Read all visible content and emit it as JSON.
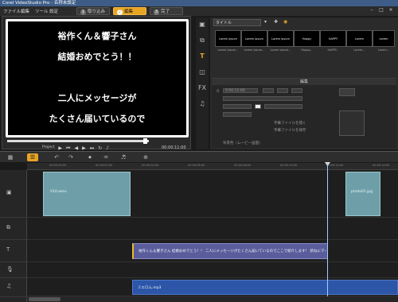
{
  "window": {
    "title": "Corel VideoStudio Pro - 名称未設定"
  },
  "menu": [
    "ファイル",
    "編集",
    "ツール",
    "設定"
  ],
  "steps": [
    {
      "num": "1",
      "label": "取り込み",
      "active": false
    },
    {
      "num": "2",
      "label": "編集",
      "active": true
    },
    {
      "num": "3",
      "label": "完了",
      "active": false
    }
  ],
  "preview": {
    "lines": [
      "裕作くん＆響子さん",
      "結婚おめでとう！！",
      "",
      "二人にメッセージが",
      "たくさん届いているので"
    ],
    "progress": 0.97,
    "mode_label": "Project",
    "timecode": "00:00:11:00"
  },
  "library": {
    "category": "タイトル",
    "thumbs": [
      {
        "text": "Lorem ipsum",
        "label": "Lorem ipsum..."
      },
      {
        "text": "Lorem ipsum",
        "label": "Lorem ipsum..."
      },
      {
        "text": "Lorem ipsum",
        "label": "Lorem ipsum..."
      },
      {
        "text": "Happy",
        "label": "Happy..."
      },
      {
        "text": "HAPPY",
        "label": "HAPPY..."
      },
      {
        "text": "Lorem",
        "label": "Lorem..."
      },
      {
        "text": "Lorem",
        "label": "Lorem..."
      }
    ],
    "edit_header": "編集",
    "edit_timecode": "0:00:11:00",
    "style_file": "字幕ファイルを開く",
    "save_style": "字幕ファイルを保存",
    "text_bg": "背景色（ムービー画面）"
  },
  "timeline": {
    "ruler": [
      "00:00:00:00",
      "00:00:02:00",
      "00:00:04:00",
      "00:00:06:00",
      "00:00:08:00",
      "00:00:10:00",
      "00:00:12:00",
      "00:00:14:00",
      "00:00:16:00"
    ],
    "video_clip_1": "V10.wmv",
    "video_clip_2": "photo01.jpg",
    "title_clip": "裕作くん＆響子さん 結婚おめでとう！！ 二人にメッセージがたくさん届いているのでここで紹介します！ 新ねにマー",
    "audio_clip": "ミエロム.mp3"
  },
  "colors": {
    "accent": "#e8a524",
    "video_clip": "#6e9fa8",
    "title_clip": "#5a5c9b",
    "audio_clip": "#2d56a9",
    "titlebar": "#3d5d88"
  },
  "icons": [
    "video-icon",
    "transition-icon",
    "title-icon",
    "graphic-icon",
    "fx-icon",
    "audio-icon"
  ]
}
